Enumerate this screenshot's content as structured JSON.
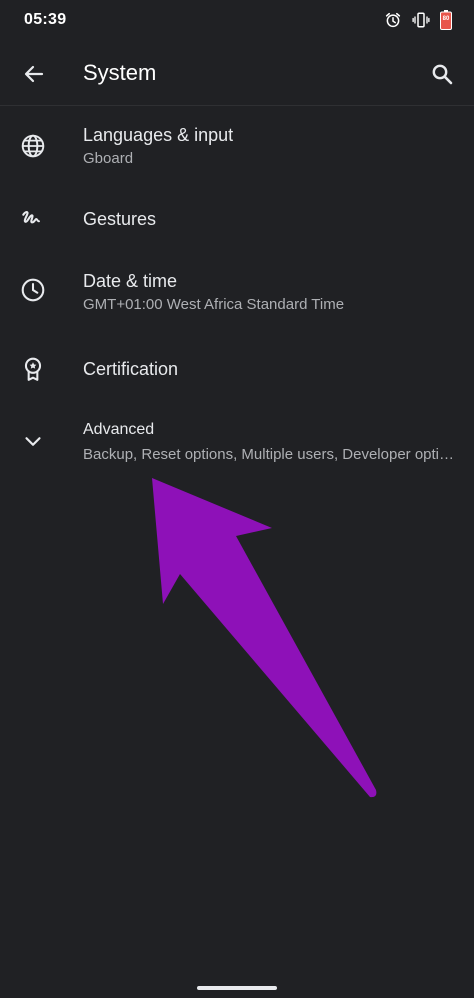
{
  "status_bar": {
    "time": "05:39",
    "icons": [
      "alarm-icon",
      "vibrate-icon",
      "battery-icon"
    ],
    "battery_level": "80"
  },
  "app_bar": {
    "title": "System",
    "back_icon": "arrow-back-icon",
    "search_icon": "search-icon"
  },
  "settings": {
    "items": [
      {
        "icon": "globe-icon",
        "title": "Languages & input",
        "subtitle": "Gboard"
      },
      {
        "icon": "gesture-icon",
        "title": "Gestures"
      },
      {
        "icon": "clock-icon",
        "title": "Date & time",
        "subtitle": "GMT+01:00 West Africa Standard Time"
      },
      {
        "icon": "certificate-icon",
        "title": "Certification"
      },
      {
        "icon": "chevron-down-icon",
        "title": "Advanced",
        "subtitle": "Backup, Reset options, Multiple users, Developer options"
      }
    ]
  },
  "colors": {
    "background": "#202124",
    "text_primary": "#e8eaed",
    "text_secondary": "#aeb0b4",
    "annotation_arrow": "#8e11b8"
  }
}
